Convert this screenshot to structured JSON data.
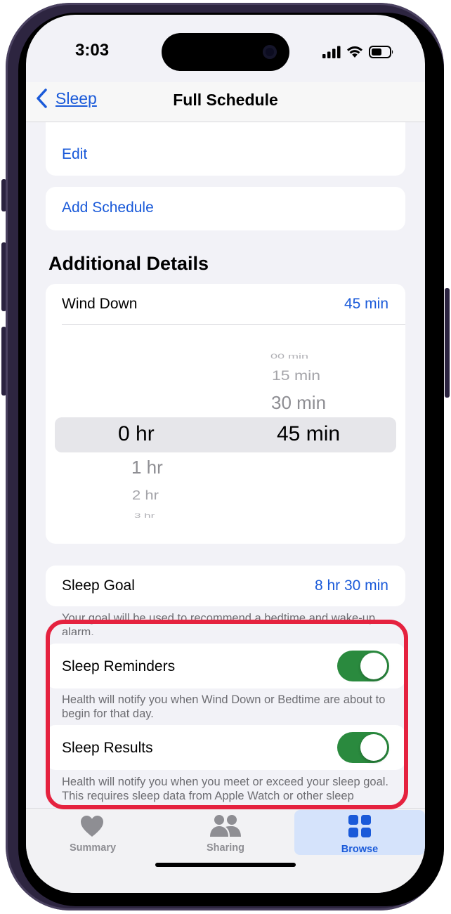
{
  "status_bar": {
    "time": "3:03"
  },
  "nav": {
    "back_label": "Sleep",
    "title": "Full Schedule"
  },
  "schedule": {
    "edit_label": "Edit",
    "add_schedule_label": "Add Schedule"
  },
  "additional_details": {
    "section_title": "Additional Details",
    "wind_down": {
      "label": "Wind Down",
      "value": "45 min",
      "picker": {
        "hours": [
          "0 hr",
          "1 hr",
          "2 hr",
          "3 hr"
        ],
        "selected_hours": "0 hr",
        "minutes": [
          "00 min",
          "15 min",
          "30 min",
          "45 min"
        ],
        "selected_minutes": "45 min"
      }
    },
    "sleep_goal": {
      "label": "Sleep Goal",
      "value": "8 hr 30 min",
      "footnote": "Your goal will be used to recommend a bedtime and wake-up alarm."
    },
    "sleep_reminders": {
      "label": "Sleep Reminders",
      "enabled": true,
      "footnote": "Health will notify you when Wind Down or Bedtime are about to begin for that day."
    },
    "sleep_results": {
      "label": "Sleep Results",
      "enabled": true,
      "footnote": "Health will notify you when you meet or exceed your sleep goal. This requires sleep data from Apple Watch or other sleep tracking apps and hardware."
    }
  },
  "tab_bar": {
    "tabs": [
      {
        "label": "Summary",
        "icon": "heart-icon",
        "active": false
      },
      {
        "label": "Sharing",
        "icon": "people-icon",
        "active": false
      },
      {
        "label": "Browse",
        "icon": "grid-icon",
        "active": true
      }
    ]
  },
  "colors": {
    "accent": "#1a5ad9",
    "toggle_on": "#2a8a3e",
    "highlight": "#e5223f"
  }
}
